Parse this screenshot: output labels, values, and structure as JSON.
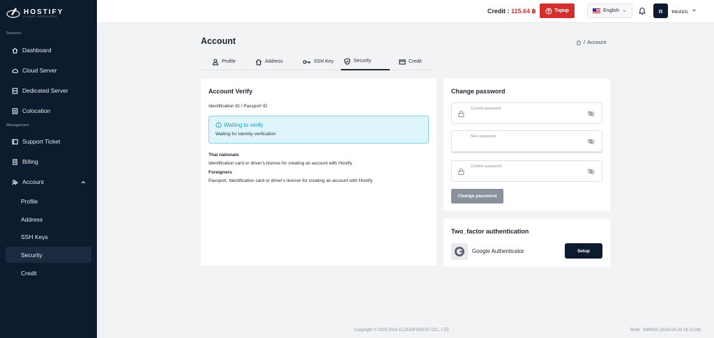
{
  "brand": {
    "name": "HOSTIFY",
    "tagline": "CLOUD SERVICES"
  },
  "sidebar": {
    "sections": [
      {
        "label": "Services"
      },
      {
        "label": "Management"
      }
    ],
    "items": [
      {
        "label": "Dashboard",
        "icon": "home-icon"
      },
      {
        "label": "Cloud Server",
        "icon": "cloud-icon"
      },
      {
        "label": "Dedicated Server",
        "icon": "server-icon"
      },
      {
        "label": "Colocation",
        "icon": "rack-icon"
      },
      {
        "label": "Support Ticket",
        "icon": "ticket-icon"
      },
      {
        "label": "Billing",
        "icon": "billing-icon"
      },
      {
        "label": "Account",
        "icon": "account-icon",
        "expanded": true
      }
    ],
    "sub_items": [
      {
        "label": "Profile"
      },
      {
        "label": "Address"
      },
      {
        "label": "SSH Keys"
      },
      {
        "label": "Security",
        "active": true
      },
      {
        "label": "Credit"
      }
    ]
  },
  "header": {
    "credit_label": "Credit : ",
    "credit_amount": "115.64 ฿",
    "topup_label": "Topup",
    "language": "English",
    "avatar_letter": "n",
    "username": "ทดสอบ"
  },
  "page": {
    "title": "Account",
    "breadcrumb_current": "Account",
    "tabs": [
      {
        "label": "Profile",
        "icon": "user-icon"
      },
      {
        "label": "Address",
        "icon": "home-icon"
      },
      {
        "label": "SSH Key",
        "icon": "key-icon"
      },
      {
        "label": "Security",
        "icon": "shield-icon",
        "active": true
      },
      {
        "label": "Credit",
        "icon": "card-icon"
      }
    ]
  },
  "verify": {
    "title": "Account Verify",
    "id_label": "Identification ID / Passport ID",
    "alert_title": "Waiting to verify",
    "alert_text": "Waiting for Identity verification",
    "thai_title": "Thai nationals",
    "thai_text": "Identification card or driver's license for creating an account with Hostify",
    "foreign_title": "Foreigners",
    "foreign_text": "Passport, Identification card or driver's license for creating an account with Hostify"
  },
  "password": {
    "title": "Change password",
    "current_placeholder": "Current password",
    "new_placeholder": "New password",
    "confirm_placeholder": "Confirm password",
    "button": "Change password"
  },
  "twofactor": {
    "title": "Two_factor authentication",
    "app": "Google Authenticator",
    "button": "Setup"
  },
  "footer": {
    "copyright": "Copyright © 2020-2024 CLOUDFOREST CO., LTD.",
    "build": "Build : 48f80d1 (2024-04-23 18:15:08)"
  },
  "colors": {
    "sidebar": "#0d1b2e",
    "accent_red": "#d32f2f",
    "info": "#16a2c2"
  }
}
